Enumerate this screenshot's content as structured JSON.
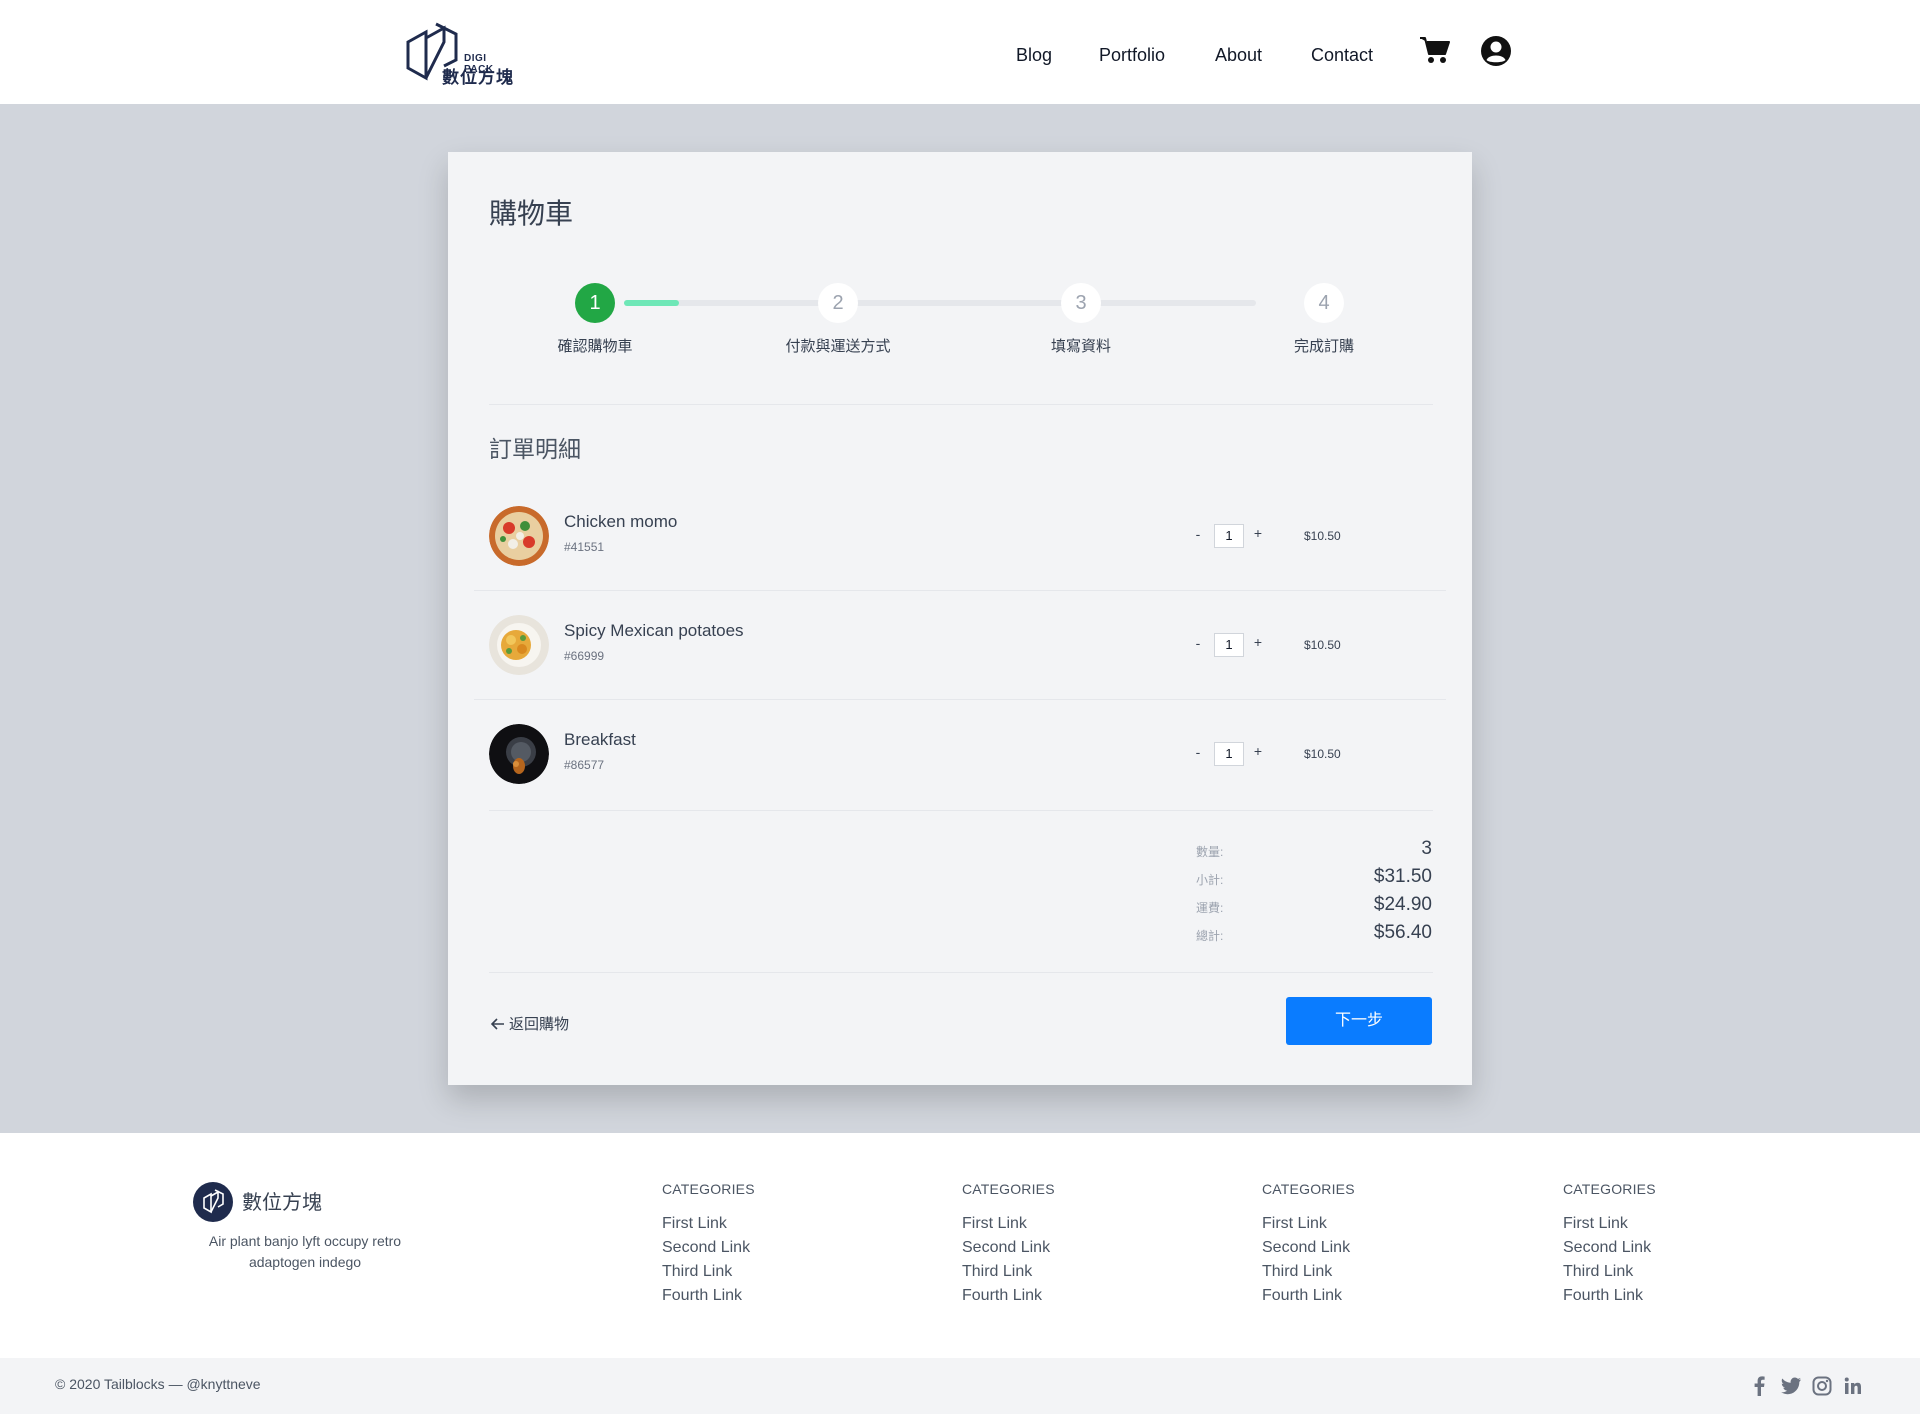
{
  "header": {
    "logo_text_en": "DIGI PACK",
    "logo_text_cn": "數位方塊",
    "nav": [
      "Blog",
      "Portfolio",
      "About",
      "Contact"
    ],
    "cart_icon": "cart-icon",
    "user_icon": "user-icon"
  },
  "card": {
    "title": "購物車",
    "steps": [
      {
        "number": "1",
        "label": "確認購物車",
        "state": "active"
      },
      {
        "number": "2",
        "label": "付款與運送方式",
        "state": "pending"
      },
      {
        "number": "3",
        "label": "填寫資料",
        "state": "pending"
      },
      {
        "number": "4",
        "label": "完成訂購",
        "state": "pending"
      }
    ],
    "section_title": "訂單明細",
    "items": [
      {
        "name": "Chicken momo",
        "sku": "#41551",
        "qty": "1",
        "price": "$10.50"
      },
      {
        "name": "Spicy Mexican potatoes",
        "sku": "#66999",
        "qty": "1",
        "price": "$10.50"
      },
      {
        "name": "Breakfast",
        "sku": "#86577",
        "qty": "1",
        "price": "$10.50"
      }
    ],
    "qty_minus": "-",
    "qty_plus": "+",
    "summary": {
      "count_label": "數量:",
      "count_value": "3",
      "subtotal_label": "小計:",
      "subtotal_value": "$31.50",
      "shipping_label": "運費:",
      "shipping_value": "$24.90",
      "total_label": "總計:",
      "total_value": "$56.40"
    },
    "back_label": "返回購物",
    "next_label": "下一步"
  },
  "footer": {
    "brand": "數位方塊",
    "description": "Air plant banjo lyft occupy retro adaptogen indego",
    "columns": [
      {
        "title": "CATEGORIES",
        "links": [
          "First Link",
          "Second Link",
          "Third Link",
          "Fourth Link"
        ]
      },
      {
        "title": "CATEGORIES",
        "links": [
          "First Link",
          "Second Link",
          "Third Link",
          "Fourth Link"
        ]
      },
      {
        "title": "CATEGORIES",
        "links": [
          "First Link",
          "Second Link",
          "Third Link",
          "Fourth Link"
        ]
      },
      {
        "title": "CATEGORIES",
        "links": [
          "First Link",
          "Second Link",
          "Third Link",
          "Fourth Link"
        ]
      }
    ],
    "copyright": "© 2020 Tailblocks — @knyttneve",
    "social": [
      "facebook-icon",
      "twitter-icon",
      "instagram-icon",
      "linkedin-icon"
    ]
  },
  "colors": {
    "accent": "#0a7cff",
    "step_active": "#22a745",
    "step_progress": "#6ee7b7",
    "page_bg": "#d1d5dc",
    "card_bg": "#f3f4f6",
    "brand_navy": "#1f2b4d"
  }
}
